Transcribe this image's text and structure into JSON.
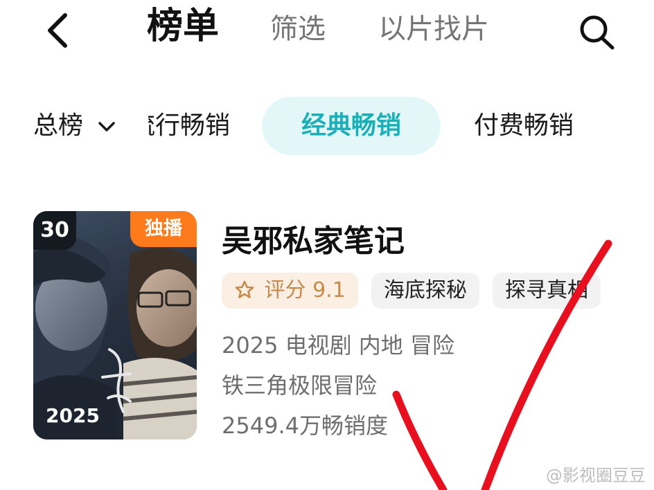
{
  "header": {
    "tabs": [
      {
        "label": "榜单",
        "active": true
      },
      {
        "label": "筛选",
        "active": false
      },
      {
        "label": "以片找片",
        "active": false
      }
    ]
  },
  "subtabs": {
    "dropdown_label": "总榜",
    "items": [
      {
        "label": "流行畅销",
        "active": false
      },
      {
        "label": "经典畅销",
        "active": true
      },
      {
        "label": "付费畅销",
        "active": false
      }
    ]
  },
  "item": {
    "rank": "30",
    "badge": "独播",
    "poster_year": "2025",
    "title": "吴邪私家笔记",
    "score_label": "评分 9.1",
    "tags": [
      "海底探秘",
      "探寻真相"
    ],
    "meta_line": "2025 电视剧 内地 冒险",
    "tagline": "铁三角极限冒险",
    "sales": "2549.4万畅销度"
  },
  "watermark": "@影视圈豆豆",
  "colors": {
    "accent": "#19b0b8",
    "accent_bg": "#e4f7f8",
    "badge_orange": "#ff7a1a",
    "score_text": "#c78a4a",
    "overlay_red": "#e8101f"
  }
}
